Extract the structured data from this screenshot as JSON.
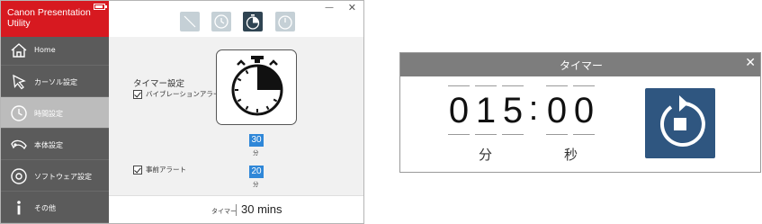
{
  "app": {
    "title": "Canon Presentation Utility",
    "accent_color": "#d71920",
    "sidebar_color": "#5b5b5b",
    "nav_items": [
      {
        "label": "Home",
        "icon": "home-icon"
      },
      {
        "label": "カーソル設定",
        "icon": "cursor-icon"
      },
      {
        "label": "時間設定",
        "icon": "clock-icon",
        "active": true
      },
      {
        "label": "本体設定",
        "icon": "device-icon"
      },
      {
        "label": "ソフトウェア設定",
        "icon": "disc-icon"
      },
      {
        "label": "その他",
        "icon": "info-icon"
      }
    ],
    "mode_buttons": [
      {
        "icon": "slash-icon",
        "state": "inactive"
      },
      {
        "icon": "clock-icon",
        "state": "inactive"
      },
      {
        "icon": "stopwatch-icon",
        "state": "selected"
      },
      {
        "icon": "timer-icon",
        "state": "inactive"
      }
    ],
    "window_controls": {
      "minimize": "—",
      "close": "✕"
    }
  },
  "timer_settings": {
    "section_title": "タイマー設定",
    "vibration_alert": {
      "label": "バイブレーションアラート",
      "checked": true,
      "value": "30",
      "unit": "分"
    },
    "advance_alert": {
      "label": "事前アラート",
      "checked": true,
      "value": "20",
      "unit": "分"
    },
    "stopwatch_elapsed_fraction": 0.25,
    "footer": {
      "label": "タイマー",
      "value": "30 mins"
    },
    "value_box_color": "#2f87d8"
  },
  "timer_window": {
    "title": "タイマー",
    "close": "✕",
    "digits": [
      "0",
      "1",
      "5",
      "0",
      "0"
    ],
    "colon": ":",
    "minutes_unit": "分",
    "seconds_unit": "秒",
    "reset_button_color": "#2f5680"
  }
}
